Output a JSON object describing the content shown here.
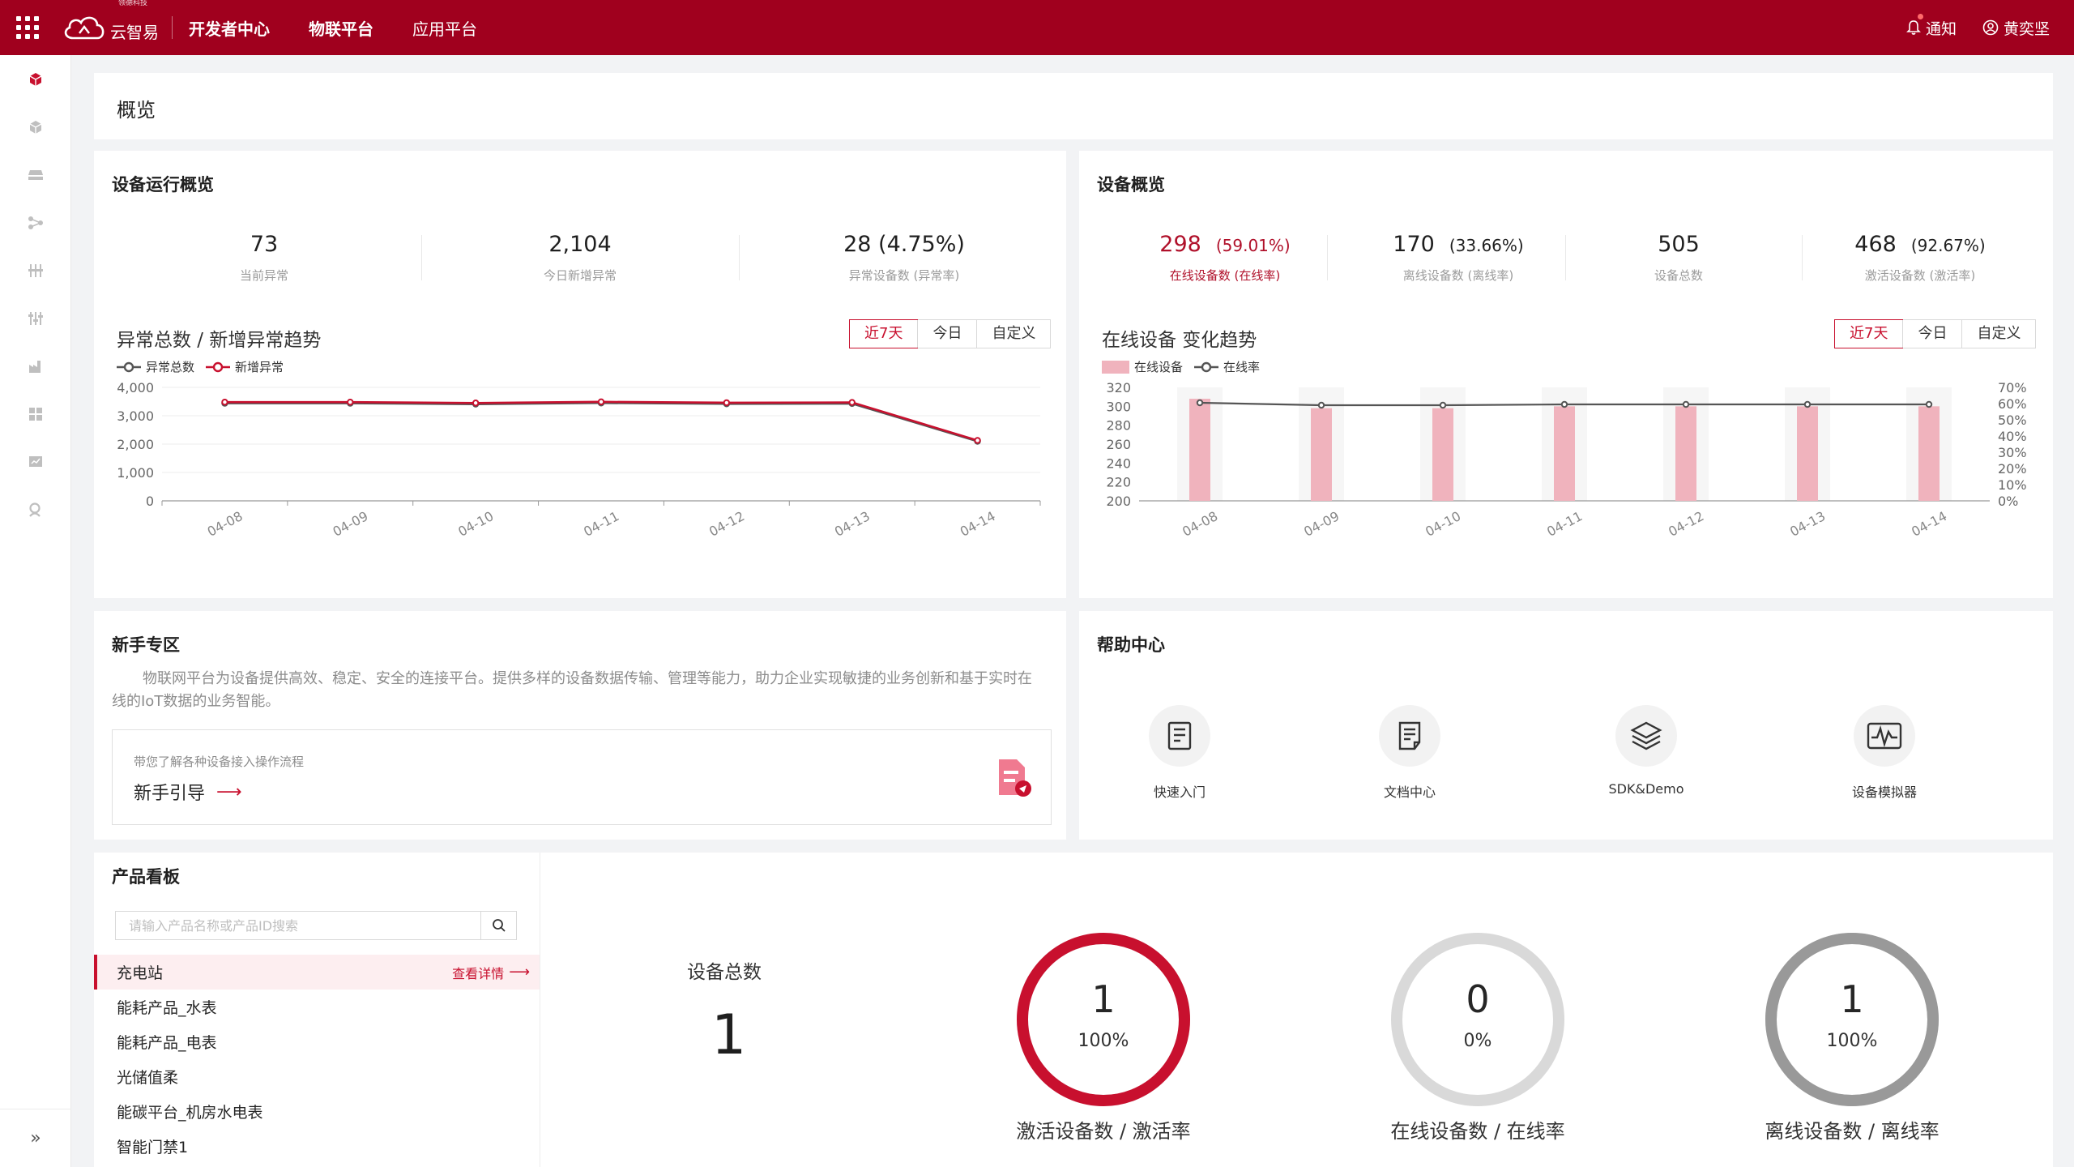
{
  "topbar": {
    "logo_sub": "领德科技",
    "logo_text": "云智易",
    "nav": [
      "开发者中心",
      "物联平台",
      "应用平台"
    ],
    "notify": "通知",
    "user": "黄奕坚"
  },
  "sidebar": {
    "icons": [
      "cube-icon",
      "cube-outline-icon",
      "device-icon",
      "topology-icon",
      "rule-icon",
      "settings-sliders-icon",
      "factory-icon",
      "grid-apps-icon",
      "monitor-icon",
      "user-search-icon"
    ],
    "collapse": "»"
  },
  "overview": {
    "title": "概览"
  },
  "device_run": {
    "title": "设备运行概览",
    "stats": [
      {
        "value": "73",
        "label": "当前异常"
      },
      {
        "value": "2,104",
        "label": "今日新增异常"
      },
      {
        "value": "28 (4.75%)",
        "label": "异常设备数 (异常率)"
      }
    ],
    "chart_title": "异常总数 / 新增异常趋势",
    "tabs": [
      "近7天",
      "今日",
      "自定义"
    ],
    "legend": [
      "异常总数",
      "新增异常"
    ]
  },
  "device_overview": {
    "title": "设备概览",
    "stats": [
      {
        "value": "298",
        "pct": "(59.01%)",
        "label": "在线设备数 (在线率)"
      },
      {
        "value": "170",
        "pct": "(33.66%)",
        "label": "离线设备数 (离线率)"
      },
      {
        "value": "505",
        "pct": "",
        "label": "设备总数"
      },
      {
        "value": "468",
        "pct": "(92.67%)",
        "label": "激活设备数 (激活率)"
      }
    ],
    "chart_title": "在线设备 变化趋势",
    "tabs": [
      "近7天",
      "今日",
      "自定义"
    ],
    "legend": [
      "在线设备",
      "在线率"
    ]
  },
  "chart_data": [
    {
      "type": "line",
      "categories": [
        "04-08",
        "04-09",
        "04-10",
        "04-11",
        "04-12",
        "04-13",
        "04-14"
      ],
      "series": [
        {
          "name": "异常总数",
          "values": [
            3440,
            3440,
            3410,
            3450,
            3420,
            3430,
            2100
          ]
        },
        {
          "name": "新增异常",
          "values": [
            3480,
            3480,
            3450,
            3490,
            3460,
            3470,
            2130
          ]
        }
      ],
      "ylim": [
        0,
        4000
      ],
      "yticks": [
        "4,000",
        "3,000",
        "2,000",
        "1,000",
        "0"
      ],
      "grid": true,
      "legend": "top-left"
    },
    {
      "type": "bar",
      "categories": [
        "04-08",
        "04-09",
        "04-10",
        "04-11",
        "04-12",
        "04-13",
        "04-14"
      ],
      "series": [
        {
          "name": "在线设备",
          "values": [
            308,
            298,
            298,
            300,
            300,
            300,
            300
          ]
        },
        {
          "name": "在线率",
          "values": [
            60.5,
            59.0,
            59.0,
            59.5,
            59.5,
            59.5,
            59.5
          ]
        }
      ],
      "ylim": [
        200,
        320
      ],
      "yticks": [
        "320",
        "300",
        "280",
        "260",
        "240",
        "220",
        "200"
      ],
      "y2lim": [
        0,
        70
      ],
      "y2ticks": [
        "70%",
        "60%",
        "50%",
        "40%",
        "30%",
        "20%",
        "10%",
        "0%"
      ],
      "grid": false,
      "legend": "top-left"
    }
  ],
  "newbie": {
    "title": "新手专区",
    "intro": "物联网平台为设备提供高效、稳定、安全的连接平台。提供多样的设备数据传输、管理等能力，助力企业实现敏捷的业务创新和基于实时在线的IoT数据的业务智能。",
    "guide_sub": "带您了解各种设备接入操作流程",
    "guide_link": "新手引导",
    "arrow": "⟶"
  },
  "help": {
    "title": "帮助中心",
    "items": [
      {
        "label": "快速入门",
        "icon": "quick-start-icon"
      },
      {
        "label": "文档中心",
        "icon": "document-icon"
      },
      {
        "label": "SDK&Demo",
        "icon": "layers-icon"
      },
      {
        "label": "设备模拟器",
        "icon": "simulator-wave-icon"
      }
    ]
  },
  "product_board": {
    "title": "产品看板",
    "search_placeholder": "请输入产品名称或产品ID搜索",
    "detail": "查看详情",
    "arrow": "⟶",
    "items": [
      "充电站",
      "能耗产品_水表",
      "能耗产品_电表",
      "光储值柔",
      "能碳平台_机房水电表",
      "智能门禁1"
    ],
    "total_label": "设备总数",
    "total_value": "1",
    "rings": [
      {
        "value": "1",
        "pct": "100%",
        "fraction": 1.0,
        "color": "#c8102e",
        "caption": "激活设备数 / 激活率"
      },
      {
        "value": "0",
        "pct": "0%",
        "fraction": 0.0,
        "color": "#d4d4d4",
        "caption": "在线设备数 / 在线率"
      },
      {
        "value": "1",
        "pct": "100%",
        "fraction": 1.0,
        "color": "#999999",
        "caption": "离线设备数 / 离线率"
      }
    ]
  }
}
